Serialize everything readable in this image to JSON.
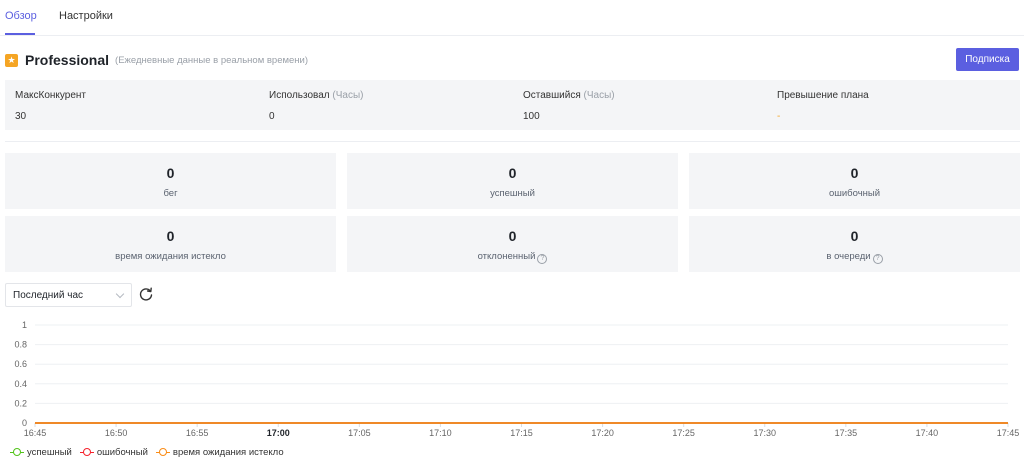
{
  "tabs": [
    {
      "label": "Обзор",
      "active": true
    },
    {
      "label": "Настройки",
      "active": false
    }
  ],
  "plan": {
    "name": "Professional",
    "note": "(Ежедневные данные в реальном времени)",
    "subscribe_label": "Подписка",
    "columns": [
      {
        "label": "МаксКонкурент",
        "unit": "",
        "value": "30"
      },
      {
        "label": "Использовал",
        "unit": "(Часы)",
        "value": "0"
      },
      {
        "label": "Оставшийся",
        "unit": "(Часы)",
        "value": "100"
      },
      {
        "label": "Превышение плана",
        "unit": "",
        "value": "-"
      }
    ]
  },
  "stats": [
    {
      "value": "0",
      "label": "бег",
      "help": false
    },
    {
      "value": "0",
      "label": "успешный",
      "help": false
    },
    {
      "value": "0",
      "label": "ошибочный",
      "help": false
    },
    {
      "value": "0",
      "label": "время ожидания истекло",
      "help": false
    },
    {
      "value": "0",
      "label": "отклоненный",
      "help": true
    },
    {
      "value": "0",
      "label": "в очереди",
      "help": true
    }
  ],
  "filter": {
    "time_range": "Последний час"
  },
  "colors": {
    "accent": "#5b5fe0",
    "plan_badge": "#f5a524",
    "success": "#52c41a",
    "error": "#f5222d",
    "timeout": "#fa8c16"
  },
  "chart_data": {
    "type": "line",
    "x": [
      "16:45",
      "16:50",
      "16:55",
      "17:00",
      "17:05",
      "17:10",
      "17:15",
      "17:20",
      "17:25",
      "17:30",
      "17:35",
      "17:40",
      "17:45"
    ],
    "x_bold": [
      "17:00"
    ],
    "y_ticks": [
      "0",
      "0.2",
      "0.4",
      "0.6",
      "0.8",
      "1"
    ],
    "ylim": [
      0,
      1
    ],
    "grid": true,
    "legend_position": "bottom-left",
    "series": [
      {
        "name": "успешный",
        "color": "#52c41a",
        "values": [
          0,
          0,
          0,
          0,
          0,
          0,
          0,
          0,
          0,
          0,
          0,
          0,
          0
        ]
      },
      {
        "name": "ошибочный",
        "color": "#f5222d",
        "values": [
          0,
          0,
          0,
          0,
          0,
          0,
          0,
          0,
          0,
          0,
          0,
          0,
          0
        ]
      },
      {
        "name": "время ожидания истекло",
        "color": "#fa8c16",
        "values": [
          0,
          0,
          0,
          0,
          0,
          0,
          0,
          0,
          0,
          0,
          0,
          0,
          0
        ]
      }
    ]
  }
}
